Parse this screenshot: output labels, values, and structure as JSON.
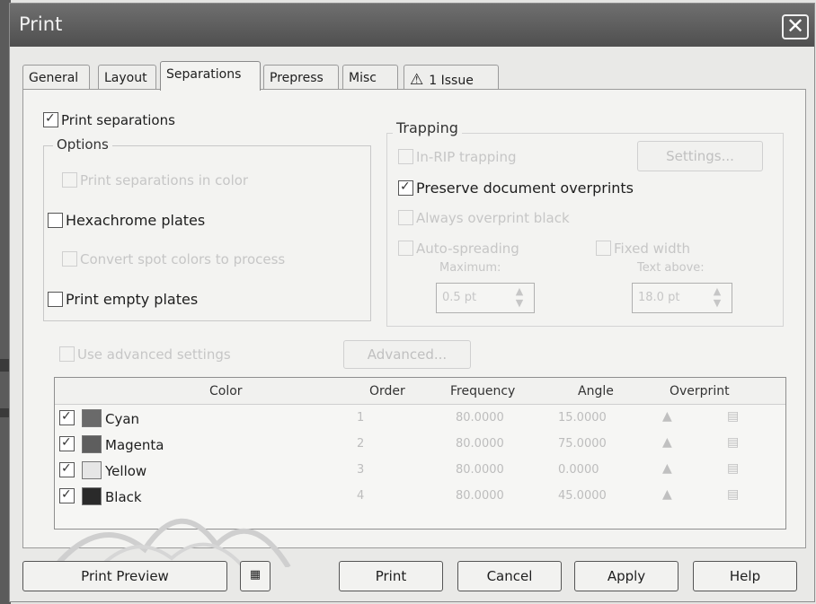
{
  "window": {
    "title": "Print",
    "close_glyph": "✕"
  },
  "tabs": [
    {
      "label": "General"
    },
    {
      "label": "Layout"
    },
    {
      "label": "Separations",
      "active": true
    },
    {
      "label": "Prepress"
    },
    {
      "label": "Misc"
    },
    {
      "label": "1 Issue",
      "icon": "warning-icon"
    }
  ],
  "separations": {
    "print_separations": {
      "label": "Print separations",
      "checked": true
    },
    "options": {
      "title": "Options",
      "print_in_color": {
        "label": "Print separations in color",
        "checked": false,
        "enabled": false
      },
      "hexachrome": {
        "label": "Hexachrome plates",
        "checked": false,
        "enabled": true
      },
      "convert_spot": {
        "label": "Convert spot colors to process",
        "checked": false,
        "enabled": false
      },
      "print_empty": {
        "label": "Print empty plates",
        "checked": false,
        "enabled": true
      }
    },
    "trapping": {
      "title": "Trapping",
      "inrip": {
        "label": "In-RIP trapping",
        "checked": false,
        "enabled": false
      },
      "settings_button": "Settings...",
      "preserve_overprints": {
        "label": "Preserve document overprints",
        "checked": true,
        "enabled": true
      },
      "always_overprint_black": {
        "label": "Always overprint black",
        "checked": false,
        "enabled": false
      },
      "auto_spreading": {
        "label": "Auto-spreading",
        "checked": false,
        "enabled": false
      },
      "fixed_width": {
        "label": "Fixed width",
        "checked": false,
        "enabled": false
      },
      "maximum_label": "Maximum:",
      "maximum_value": "0.5 pt",
      "text_above_label": "Text above:",
      "text_above_value": "18.0 pt"
    },
    "advanced": {
      "label": "Use advanced settings",
      "checked": false,
      "enabled": false
    },
    "advanced_button": "Advanced..."
  },
  "table": {
    "headers": {
      "color": "Color",
      "order": "Order",
      "frequency": "Frequency",
      "angle": "Angle",
      "overprint": "Overprint"
    },
    "rows": [
      {
        "name": "Cyan",
        "swatch": "#6a6a6a",
        "order": "1",
        "frequency": "80.0000",
        "angle": "15.0000",
        "checked": true
      },
      {
        "name": "Magenta",
        "swatch": "#5e5e5e",
        "order": "2",
        "frequency": "80.0000",
        "angle": "75.0000",
        "checked": true
      },
      {
        "name": "Yellow",
        "swatch": "#e6e6e6",
        "order": "3",
        "frequency": "80.0000",
        "angle": "0.0000",
        "checked": true
      },
      {
        "name": "Black",
        "swatch": "#2a2a2a",
        "order": "4",
        "frequency": "80.0000",
        "angle": "45.0000",
        "checked": true
      }
    ]
  },
  "footer": {
    "print_preview": "Print Preview",
    "print": "Print",
    "cancel": "Cancel",
    "apply": "Apply",
    "help": "Help"
  }
}
